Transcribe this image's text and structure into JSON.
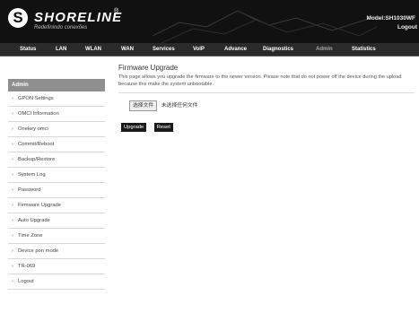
{
  "header": {
    "brand": "SHORELINE",
    "reg_mark": "®",
    "tagline": "Redefinindo conexões",
    "logo_letter": "S",
    "model": "Model:SH1030WF",
    "logout": "Logout"
  },
  "nav": {
    "items": [
      {
        "label": "Status"
      },
      {
        "label": "LAN"
      },
      {
        "label": "WLAN"
      },
      {
        "label": "WAN"
      },
      {
        "label": "Services"
      },
      {
        "label": "VoIP"
      },
      {
        "label": "Advance"
      },
      {
        "label": "Diagnostics"
      },
      {
        "label": "Admin",
        "active": true
      },
      {
        "label": "Statistics"
      }
    ]
  },
  "sidebar": {
    "heading": "Admin",
    "chevron": "›",
    "items": [
      {
        "label": "GPON Settings"
      },
      {
        "label": "OMCI Information"
      },
      {
        "label": "Onekey omci"
      },
      {
        "label": "Commit/Reboot"
      },
      {
        "label": "Backup/Restore"
      },
      {
        "label": "System Log"
      },
      {
        "label": "Password"
      },
      {
        "label": "Firmware Upgrade"
      },
      {
        "label": "Auto Upgrade"
      },
      {
        "label": "Time Zone"
      },
      {
        "label": "Device pon mode"
      },
      {
        "label": "TR-069"
      },
      {
        "label": "Logout"
      }
    ]
  },
  "main": {
    "title": "Firmware Upgrade",
    "description": "This page allows you upgrade the firmware to the newer version. Please note that do not power off the device during the upload because this make the system unbootable.",
    "choose_file_label": "选择文件",
    "no_file_text": "未选择任何文件",
    "upgrade_label": "Upgrade",
    "reset_label": "Reset"
  },
  "colors": {
    "header_bg": "#111111",
    "nav_bg": "#2a2a2a",
    "sidebar_head_bg": "#8f8f8f"
  }
}
